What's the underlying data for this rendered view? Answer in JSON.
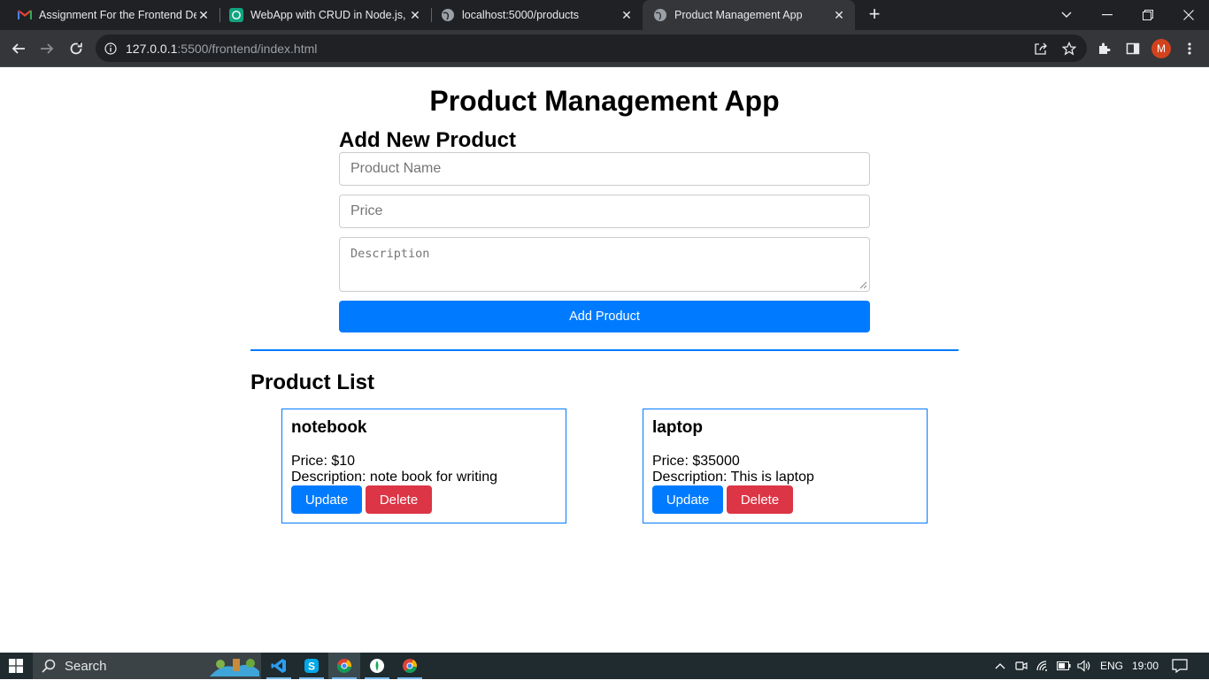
{
  "browser": {
    "tabs": [
      {
        "title": "Assignment For the Frontend De",
        "icon": "gmail-icon"
      },
      {
        "title": "WebApp with CRUD in Node.js, E",
        "icon": "chatgpt-icon"
      },
      {
        "title": "localhost:5000/products",
        "icon": "globe-icon"
      },
      {
        "title": "Product Management App",
        "icon": "globe-icon",
        "active": true
      }
    ],
    "url_host": "127.0.0.1",
    "url_rest": ":5500/frontend/index.html",
    "profile_initial": "M"
  },
  "page": {
    "title": "Product Management App",
    "add_heading": "Add New Product",
    "name_placeholder": "Product Name",
    "price_placeholder": "Price",
    "description_placeholder": "Description",
    "add_button": "Add Product",
    "list_heading": "Product List",
    "products": [
      {
        "name": "notebook",
        "price": "Price: $10",
        "description": "Description: note book for writing",
        "update": "Update",
        "delete": "Delete"
      },
      {
        "name": "laptop",
        "price": "Price: $35000",
        "description": "Description: This is laptop",
        "update": "Update",
        "delete": "Delete"
      }
    ]
  },
  "taskbar": {
    "search_label": "Search",
    "language": "ENG",
    "time": "19:00"
  },
  "colors": {
    "primary": "#007bff",
    "danger": "#dc3545",
    "tab_bg": "#202124",
    "toolbar_bg": "#35363a",
    "taskbar_bg": "#1f2b2f"
  }
}
